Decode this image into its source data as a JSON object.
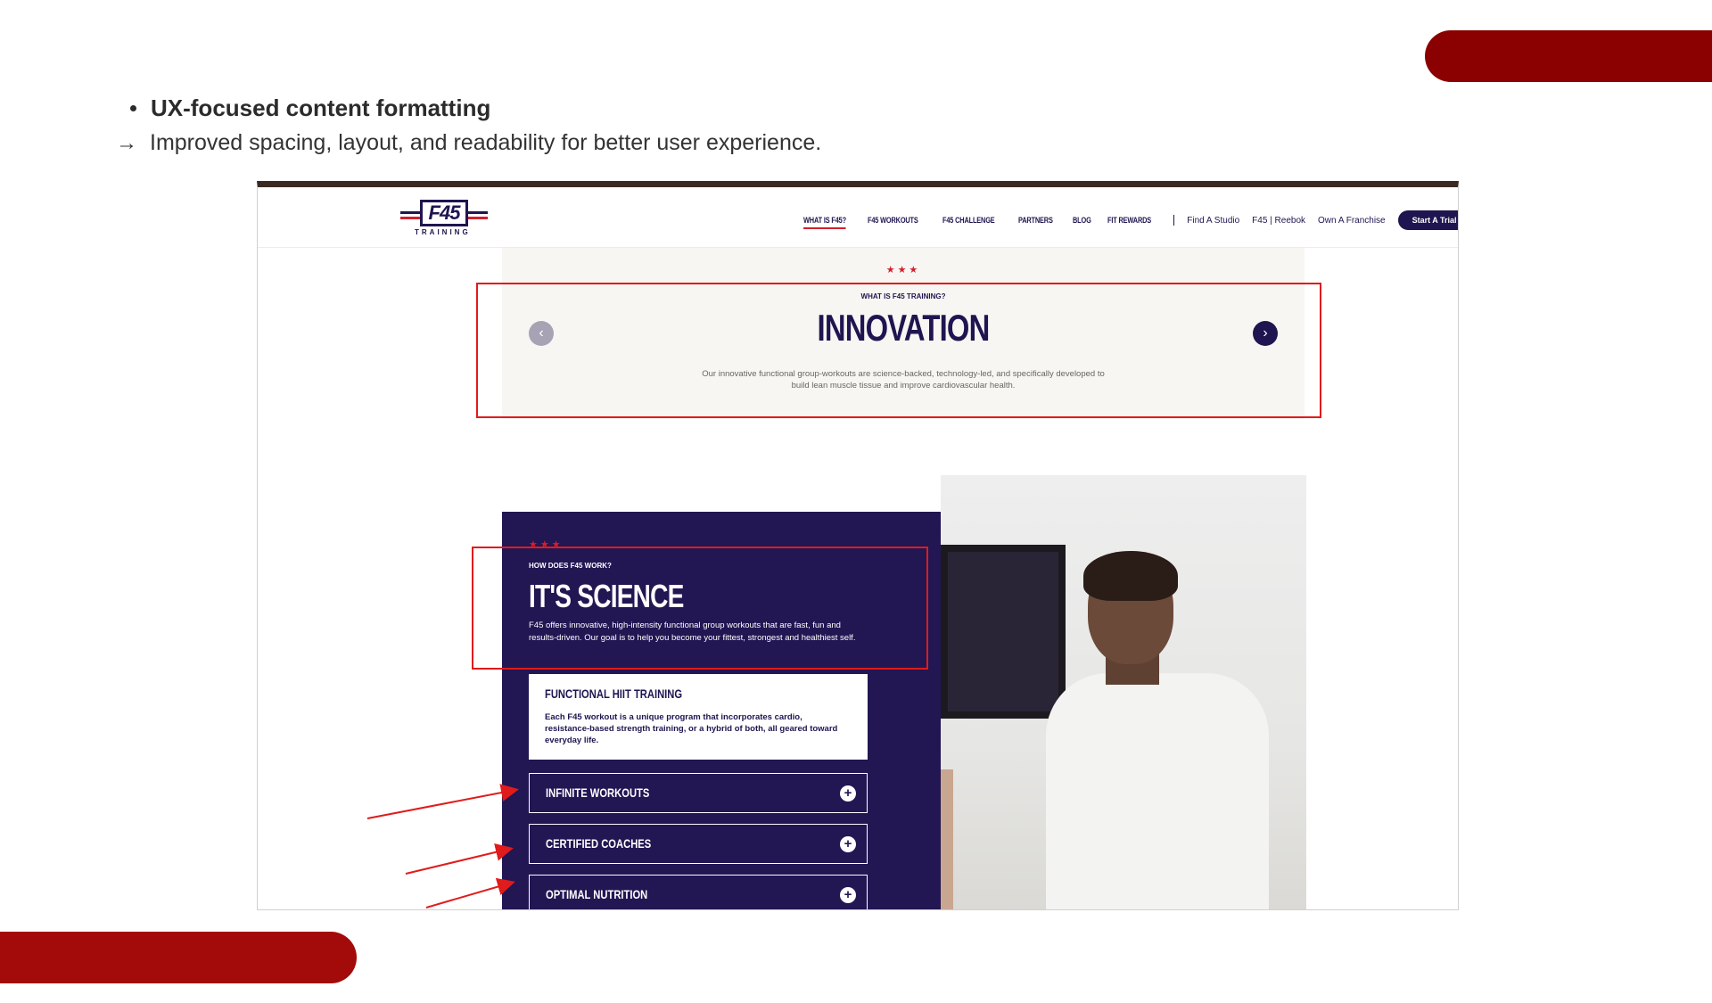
{
  "slide": {
    "bullet_heading": "UX-focused content formatting",
    "arrow_glyph": "→",
    "subtext": "Improved spacing, layout, and readability for better user experience.",
    "accent_color": "#8b0000"
  },
  "site": {
    "logo": {
      "mark": "F45",
      "tagline": "TRAINING"
    },
    "nav": {
      "items": [
        "WHAT IS F45?",
        "F45 WORKOUTS",
        "F45 CHALLENGE",
        "PARTNERS",
        "BLOG",
        "FIT REWARDS"
      ],
      "links": [
        "Find A Studio",
        "F45 | Reebok",
        "Own A Franchise"
      ],
      "cta": "Start A Trial"
    },
    "hero": {
      "stars": "★★★",
      "kicker": "WHAT IS F45 TRAINING?",
      "title": "INNOVATION",
      "description": "Our innovative functional group-workouts are science-backed, technology-led, and specifically developed to build lean muscle tissue and improve cardiovascular health."
    },
    "science": {
      "stars": "★★★",
      "kicker": "HOW DOES F45 WORK?",
      "title": "IT'S SCIENCE",
      "description": "F45 offers innovative, high-intensity functional group workouts that are fast, fun and results-driven. Our goal is to help you become your fittest, strongest and healthiest self.",
      "open_card": {
        "title": "FUNCTIONAL HIIT TRAINING",
        "text": "Each F45 workout is a unique program that incorporates cardio, resistance-based strength training, or a hybrid of both, all geared toward everyday life."
      },
      "cards": [
        "INFINITE WORKOUTS",
        "CERTIFIED COACHES",
        "OPTIMAL NUTRITION"
      ]
    },
    "brand_color": "#1f1550",
    "highlight_color": "#e01b1b"
  }
}
